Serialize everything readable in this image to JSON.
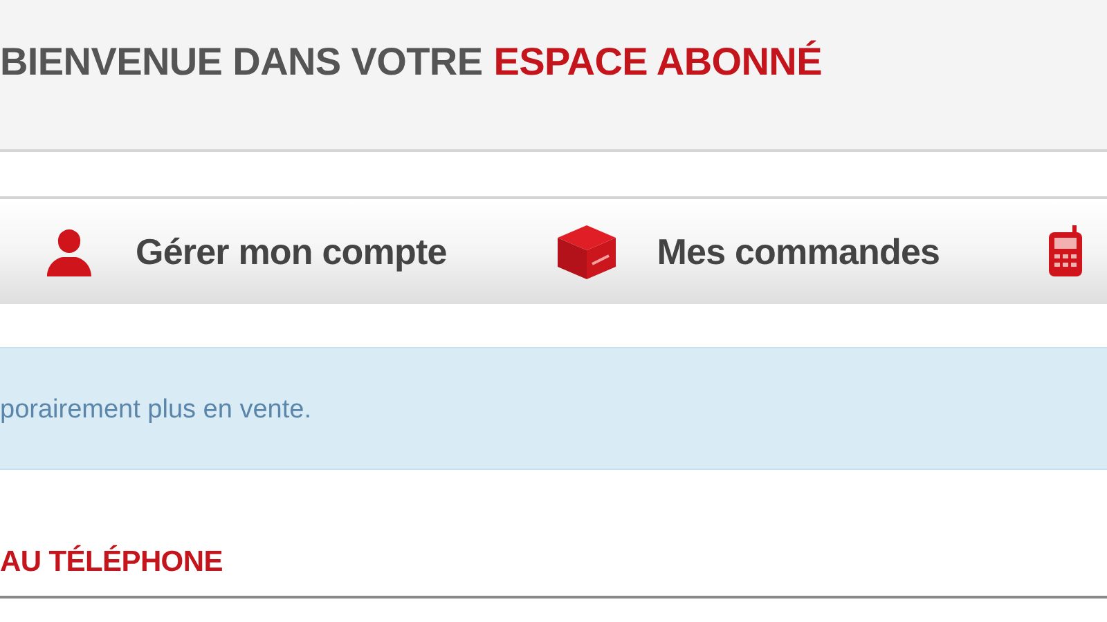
{
  "header": {
    "title": "BIENVENUE DANS VOTRE",
    "title_highlight": "ESPACE ABONNÉ"
  },
  "nav": {
    "items": [
      {
        "kind": "person",
        "label": "Gérer mon compte"
      },
      {
        "kind": "box",
        "label": "Mes commandes"
      },
      {
        "kind": "phone"
      }
    ]
  },
  "notice": {
    "text": "porairement plus en vente."
  },
  "section": {
    "title": "AU TÉLÉPHONE"
  }
}
